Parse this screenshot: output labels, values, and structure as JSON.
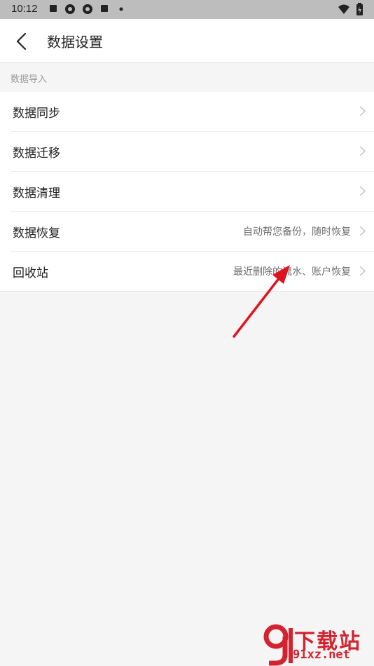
{
  "status_bar": {
    "time": "10:12"
  },
  "header": {
    "title": "数据设置"
  },
  "section": {
    "label": "数据导入"
  },
  "items": [
    {
      "label": "数据同步",
      "hint": ""
    },
    {
      "label": "数据迁移",
      "hint": ""
    },
    {
      "label": "数据清理",
      "hint": ""
    },
    {
      "label": "数据恢复",
      "hint": "自动帮您备份，随时恢复"
    },
    {
      "label": "回收站",
      "hint": "最近删除的流水、账户恢复"
    }
  ],
  "watermark": {
    "brand": "下载站",
    "url": "91xz.net"
  },
  "colors": {
    "annotation_arrow": "#e0141e",
    "watermark": "#d2232f"
  }
}
